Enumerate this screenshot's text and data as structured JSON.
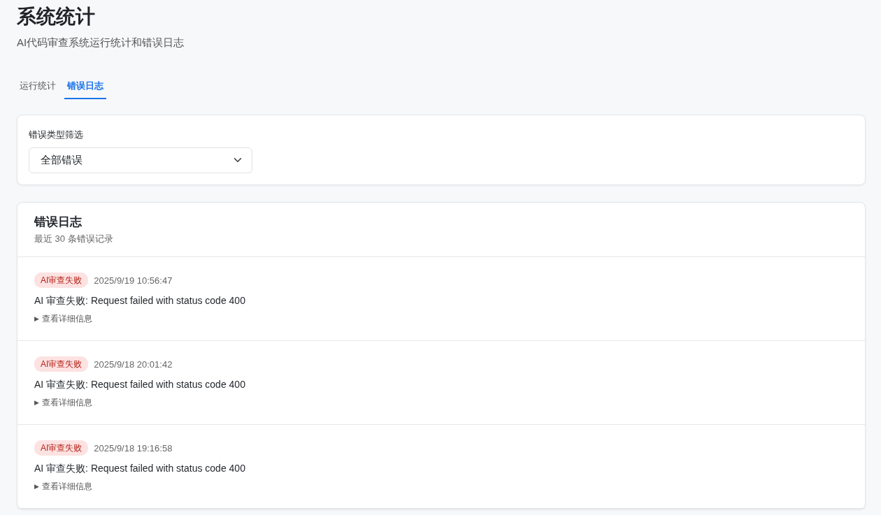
{
  "page": {
    "title": "系统统计",
    "subtitle": "AI代码审查系统运行统计和错误日志"
  },
  "tabs": [
    {
      "label": "运行统计",
      "selected": false
    },
    {
      "label": "错误日志",
      "selected": true
    }
  ],
  "filter": {
    "label": "错误类型筛选",
    "value": "全部错误"
  },
  "log": {
    "title": "错误日志",
    "subtitle": "最近 30 条错误记录",
    "entries": [
      {
        "tag": "AI审查失败",
        "time": "2025/9/19 10:56:47",
        "message": "AI 审查失败: Request failed with status code 400",
        "toggle": "▶",
        "details_label": "查看详细信息",
        "expanded": false
      },
      {
        "tag": "AI审查失败",
        "time": "2025/9/18 20:01:42",
        "message": "AI 审查失败: Request failed with status code 400",
        "toggle": "▶",
        "details_label": "查看详细信息",
        "expanded": false
      },
      {
        "tag": "AI审查失败",
        "time": "2025/9/18 19:16:58",
        "message": "AI 审查失败: Request failed with status code 400",
        "toggle": "▶",
        "details_label": "查看详细信息",
        "expanded": false
      }
    ]
  }
}
